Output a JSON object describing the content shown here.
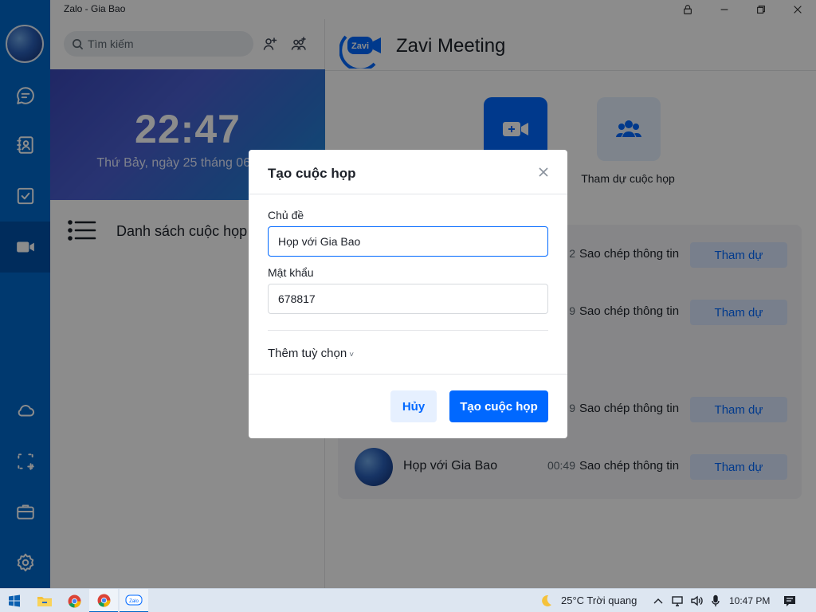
{
  "window": {
    "title": "Zalo - Gia Bao"
  },
  "sidebar": {
    "search": {
      "placeholder": "Tìm kiếm"
    },
    "clock": {
      "time": "22:47",
      "date": "Thứ Bảy, ngày 25 tháng 06 năm"
    },
    "meeting_list_label": "Danh sách cuộc họp"
  },
  "main": {
    "app_title": "Zavi Meeting",
    "logo_text": "Zavi",
    "join_label": "Tham dự cuộc họp",
    "meetings": [
      {
        "time_partial": "2",
        "copy_label": "Sao chép thông tin",
        "join_label": "Tham dự"
      },
      {
        "time_partial": "9",
        "copy_label": "Sao chép thông tin",
        "join_label": "Tham dự"
      },
      {
        "time_partial": "9",
        "copy_label": "Sao chép thông tin",
        "join_label": "Tham dự"
      },
      {
        "name": "Họp với Gia Bao",
        "time": "00:49",
        "copy_label": "Sao chép thông tin",
        "join_label": "Tham dự"
      }
    ]
  },
  "dialog": {
    "title": "Tạo cuộc họp",
    "topic_label": "Chủ đề",
    "topic_value": "Họp với Gia Bao",
    "password_label": "Mật khẩu",
    "password_value": "678817",
    "more_options": "Thêm tuỳ chọn",
    "cancel_label": "Hủy",
    "create_label": "Tạo cuộc họp"
  },
  "taskbar": {
    "zalo_label": "Zalo",
    "weather": "25°C  Trời quang",
    "time": "10:47 PM"
  },
  "colors": {
    "nav_bg": "#0069cb",
    "accent": "#0068ff",
    "accent_soft": "#dbe8ff"
  }
}
